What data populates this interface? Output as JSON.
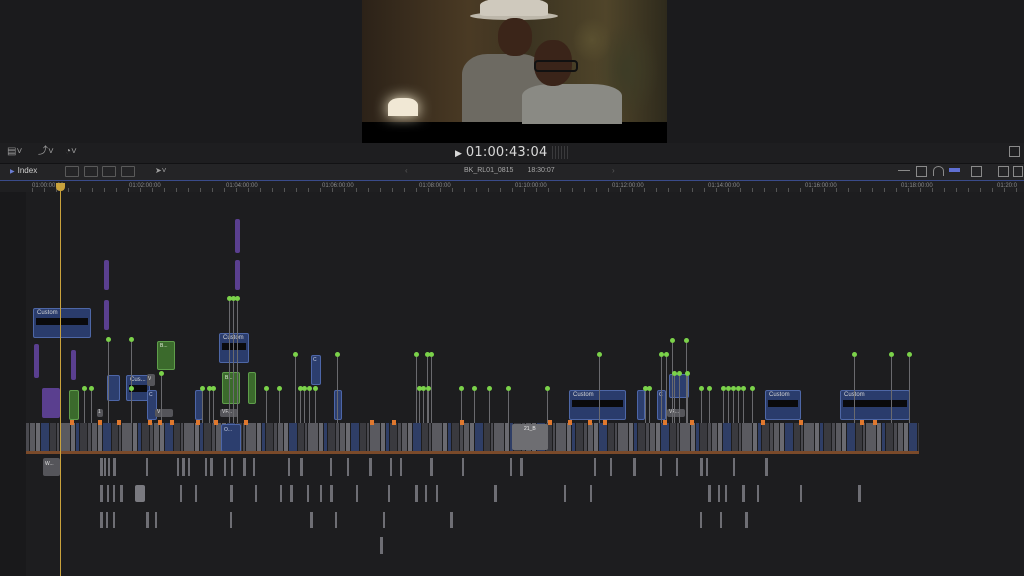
{
  "viewer": {
    "timecode": "01:00:43:04",
    "play_icon": "play-icon"
  },
  "viewer_toolbar": {
    "icons": [
      "view-options-icon",
      "transform-icon",
      "speed-icon",
      "fullscreen-icon"
    ]
  },
  "timeline_toolbar": {
    "index_label": "Index",
    "project_name": "BK_RL01_0815",
    "project_duration": "18:30:07",
    "icons": [
      "append-icon",
      "insert-icon",
      "connect-icon",
      "overwrite-icon",
      "select-tool-icon",
      "zoom-icon",
      "skimming-icon",
      "audio-skimming-icon",
      "solo-icon",
      "snapping-icon",
      "clip-appearance-icon",
      "effects-browser-icon"
    ]
  },
  "ruler": {
    "labels": [
      "01:00:00:00",
      "01:02:00:00",
      "01:04:00:00",
      "01:06:00:00",
      "01:08:00:00",
      "01:10:00:00",
      "01:12:00:00",
      "01:14:00:00",
      "01:16:00:00",
      "01:18:00:00",
      "01:20:0"
    ]
  },
  "clip_labels": {
    "custom": "Custom",
    "cus": "Cus...",
    "c": "C",
    "v": "V",
    "b": "B...",
    "vf": "VF...",
    "o": "O...",
    "w": "W...",
    "clip21": "21_B",
    "num1": "1"
  },
  "colors": {
    "accent": "#4d66a8",
    "playhead": "#c9a23c",
    "connected_title": "#2a3c6c",
    "green_clip": "#3b6a2c",
    "marker": "#e0782e",
    "keyword_dot": "#7bd24a"
  }
}
